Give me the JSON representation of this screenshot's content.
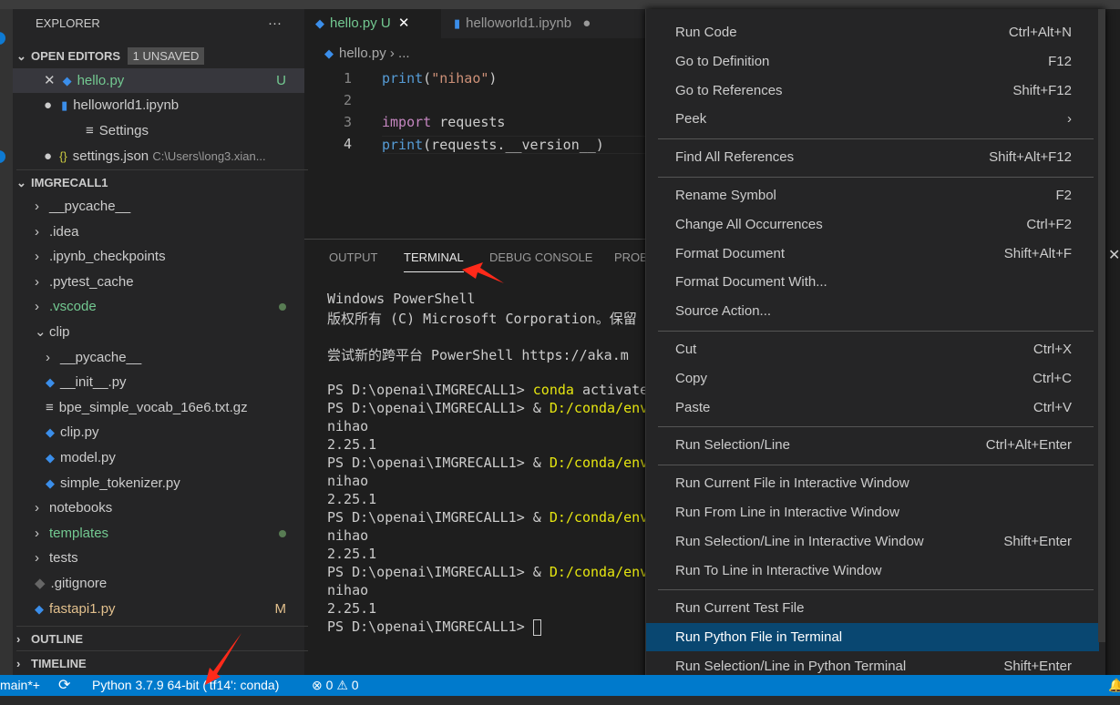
{
  "sidebar": {
    "title": "EXPLORER",
    "more": "···",
    "open_editors": {
      "label": "OPEN EDITORS",
      "badge": "1 UNSAVED",
      "items": [
        {
          "name": "hello.py",
          "status": "U"
        },
        {
          "name": "helloworld1.ipynb"
        },
        {
          "name": "Settings"
        },
        {
          "name": "settings.json",
          "path": "C:\\Users\\long3.xian..."
        }
      ]
    },
    "project": {
      "label": "IMGRECALL1",
      "items": [
        "__pycache__",
        ".idea",
        ".ipynb_checkpoints",
        ".pytest_cache",
        ".vscode",
        "clip",
        "__pycache__",
        "__init__.py",
        "bpe_simple_vocab_16e6.txt.gz",
        "clip.py",
        "model.py",
        "simple_tokenizer.py",
        "notebooks",
        "templates",
        "tests",
        ".gitignore",
        "fastapi1.py"
      ],
      "fastapi_status": "M"
    },
    "outline": "OUTLINE",
    "timeline": "TIMELINE"
  },
  "tabs": [
    {
      "label": "hello.py",
      "status": "U"
    },
    {
      "label": "helloworld1.ipynb"
    }
  ],
  "breadcrumb": {
    "file": "hello.py",
    "rest": "..."
  },
  "code": {
    "line_numbers": [
      "1",
      "2",
      "3",
      "4"
    ],
    "l1a": "print",
    "l1b": "(",
    "l1c": "\"nihao\"",
    "l1d": ")",
    "l3a": "import",
    "l3b": " requests",
    "l4a": "print",
    "l4b": "(requests.__version__)"
  },
  "panel": {
    "tabs": [
      "OUTPUT",
      "TERMINAL",
      "DEBUG CONSOLE",
      "PROB"
    ],
    "lines": [
      "Windows PowerShell",
      "版权所有 (C) Microsoft Corporation。保留",
      "",
      "尝试新的跨平台 PowerShell https://aka.m",
      ""
    ],
    "prompt": "PS D:\\openai\\IMGRECALL1> ",
    "cmd1": "conda",
    "cmd1b": " activate",
    "amp": "& ",
    "path": "D:/conda/env",
    "out1": "nihao",
    "out2": "2.25.1"
  },
  "menu": {
    "items": [
      {
        "label": "Run Code",
        "kb": "Ctrl+Alt+N"
      },
      {
        "label": "Go to Definition",
        "kb": "F12"
      },
      {
        "label": "Go to References",
        "kb": "Shift+F12"
      },
      {
        "label": "Peek",
        "kb": "›"
      },
      {
        "label": "Find All References",
        "kb": "Shift+Alt+F12"
      },
      {
        "label": "Rename Symbol",
        "kb": "F2"
      },
      {
        "label": "Change All Occurrences",
        "kb": "Ctrl+F2"
      },
      {
        "label": "Format Document",
        "kb": "Shift+Alt+F"
      },
      {
        "label": "Format Document With...",
        "kb": ""
      },
      {
        "label": "Source Action...",
        "kb": ""
      },
      {
        "label": "Cut",
        "kb": "Ctrl+X"
      },
      {
        "label": "Copy",
        "kb": "Ctrl+C"
      },
      {
        "label": "Paste",
        "kb": "Ctrl+V"
      },
      {
        "label": "Run Selection/Line",
        "kb": "Ctrl+Alt+Enter"
      },
      {
        "label": "Run Current File in Interactive Window",
        "kb": ""
      },
      {
        "label": "Run From Line in Interactive Window",
        "kb": ""
      },
      {
        "label": "Run Selection/Line in Interactive Window",
        "kb": "Shift+Enter"
      },
      {
        "label": "Run To Line in Interactive Window",
        "kb": ""
      },
      {
        "label": "Run Current Test File",
        "kb": ""
      },
      {
        "label": "Run Python File in Terminal",
        "kb": ""
      },
      {
        "label": "Run Selection/Line in Python Terminal",
        "kb": "Shift+Enter"
      }
    ],
    "highlighted": "Run Python File in Terminal"
  },
  "status": {
    "branch": "main*+",
    "sync": "⟳",
    "interpreter": "Python 3.7.9 64-bit ('tf14': conda)",
    "errors": "0",
    "warnings": "0"
  },
  "colors": {
    "accent": "#007acc",
    "highlight": "#094771",
    "annotation": "#ff2a1a"
  }
}
